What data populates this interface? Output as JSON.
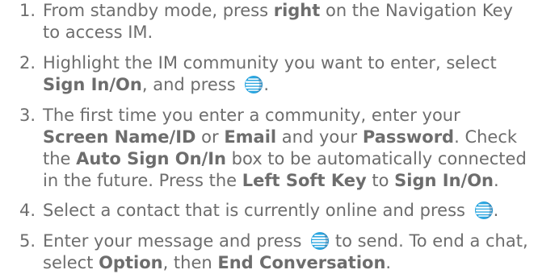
{
  "steps": [
    {
      "number": "1.",
      "parts": [
        {
          "t": "From standby mode, press "
        },
        {
          "b": "right"
        },
        {
          "t": " on the Navigation Key to access IM."
        }
      ]
    },
    {
      "number": "2.",
      "parts": [
        {
          "t": "Highlight the IM community you want to enter, select "
        },
        {
          "b": "Sign In/On"
        },
        {
          "t": ", and press "
        },
        {
          "icon": "att-globe-key-icon"
        },
        {
          "t": "."
        }
      ]
    },
    {
      "number": "3.",
      "parts": [
        {
          "t": "The first time you enter a community, enter your "
        },
        {
          "b": "Screen Name/ID"
        },
        {
          "t": " or "
        },
        {
          "b": "Email"
        },
        {
          "t": " and your "
        },
        {
          "b": "Password"
        },
        {
          "t": ". Check the "
        },
        {
          "b": "Auto Sign On/In"
        },
        {
          "t": " box to be automatically connected in the future. Press the "
        },
        {
          "b": "Left Soft Key"
        },
        {
          "t": " to "
        },
        {
          "b": "Sign In/On"
        },
        {
          "t": "."
        }
      ]
    },
    {
      "number": "4.",
      "parts": [
        {
          "t": "Select a contact that is currently online and press "
        },
        {
          "icon": "att-globe-key-icon"
        },
        {
          "t": "."
        }
      ]
    },
    {
      "number": "5.",
      "parts": [
        {
          "t": "Enter your message and press "
        },
        {
          "icon": "att-globe-key-icon"
        },
        {
          "t": " to send. To end a chat, select "
        },
        {
          "b": "Option"
        },
        {
          "t": ", then "
        },
        {
          "b": "End Conversation"
        },
        {
          "t": "."
        }
      ]
    }
  ],
  "colors": {
    "text": "#6d6d6d",
    "icon_blue": "#2aa6e0",
    "icon_dark": "#1f5f8f"
  }
}
